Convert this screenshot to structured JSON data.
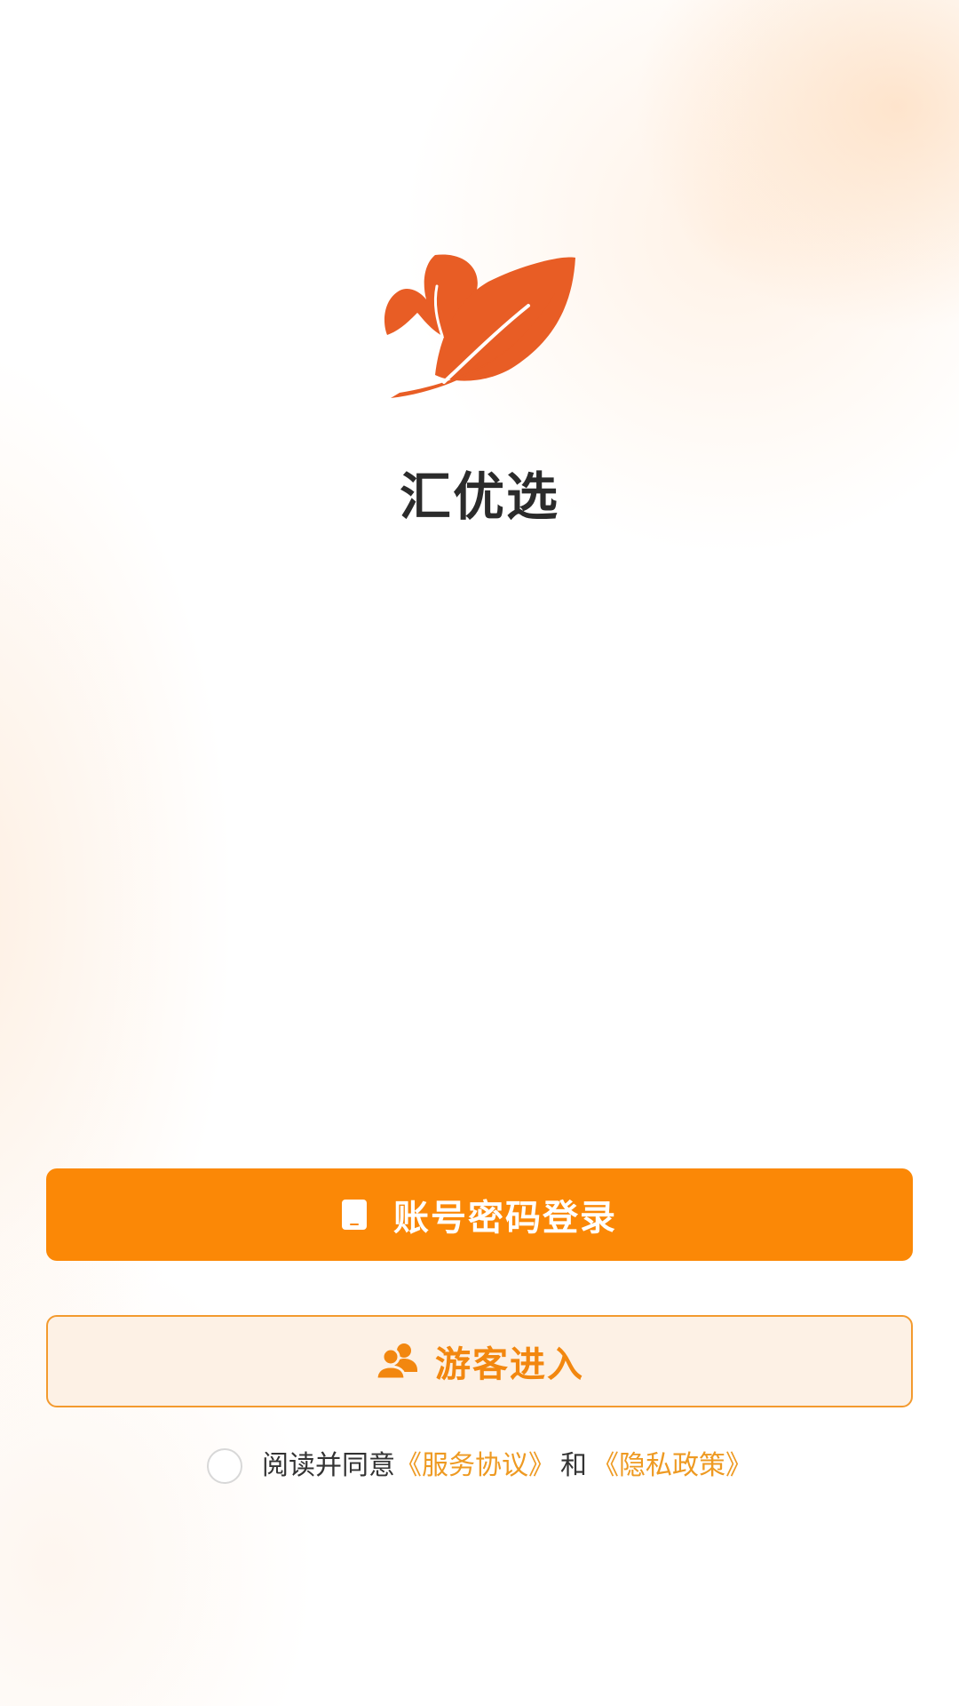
{
  "app": {
    "name": "汇优选"
  },
  "actions": {
    "account_login_label": "账号密码登录",
    "guest_login_label": "游客进入"
  },
  "agreement": {
    "prefix": "阅读并同意",
    "service_link": "《服务协议》",
    "conjunction": "和",
    "privacy_link": "《隐私政策》",
    "checked": false
  },
  "icons": {
    "logo": "leaf-logo",
    "account_login": "phone-icon",
    "guest_login": "users-icon"
  },
  "colors": {
    "brand": "#fb8806",
    "logo": "#e85d25",
    "link": "#ee9a22",
    "title": "#2b2b2b"
  }
}
